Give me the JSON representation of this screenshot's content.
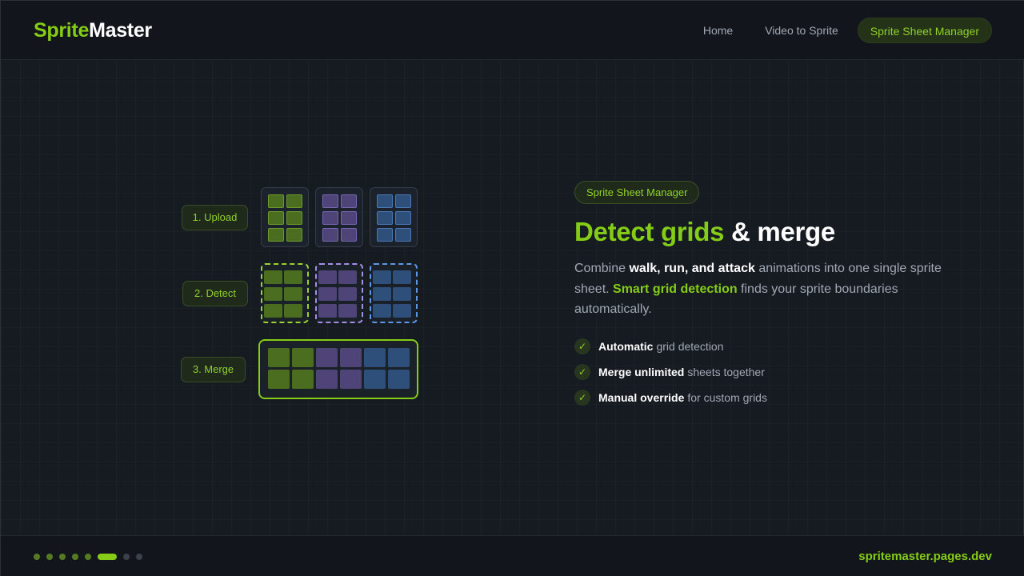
{
  "header": {
    "logo_part1": "Sprite",
    "logo_part2": "Master",
    "nav": [
      {
        "label": "Home"
      },
      {
        "label": "Video to Sprite"
      },
      {
        "label": "Sprite Sheet Manager",
        "active": true
      }
    ]
  },
  "illustration": {
    "steps": [
      "1. Upload",
      "2. Detect",
      "3. Merge"
    ],
    "colors": {
      "green": "#84cc16",
      "purple": "#a58ee8",
      "blue": "#5e97e8"
    }
  },
  "content": {
    "badge": "Sprite Sheet Manager",
    "headline_highlight": "Detect grids",
    "headline_rest": "& merge",
    "desc": {
      "p1": "Combine ",
      "b1": "walk, run, and attack",
      "p2": " animations into one single sprite sheet. ",
      "g1": "Smart grid detection",
      "p3": " finds your sprite boundaries automatically."
    },
    "features": [
      {
        "bold": "Automatic",
        "text": "grid detection"
      },
      {
        "bold": "Merge unlimited",
        "text": "sheets together"
      },
      {
        "bold": "Manual override",
        "text": "for custom grids"
      }
    ]
  },
  "footer": {
    "site": "spritemaster.pages.dev",
    "progress": {
      "total_slides": 8,
      "current": 6
    }
  }
}
